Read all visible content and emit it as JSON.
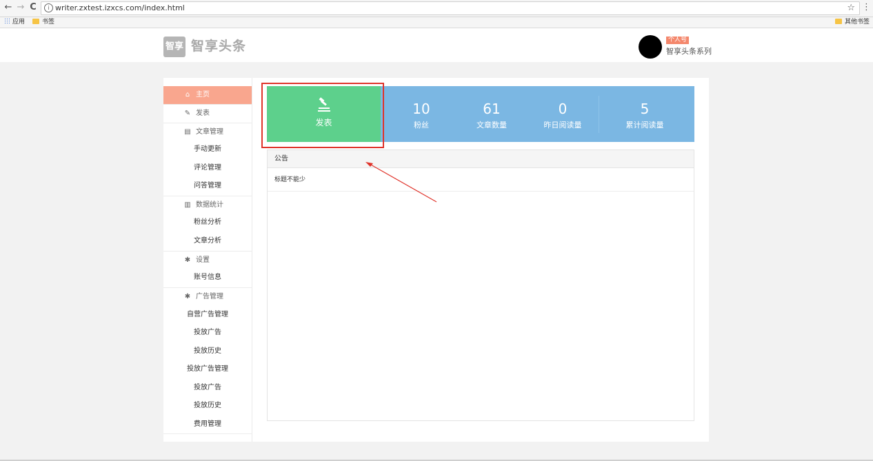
{
  "browser": {
    "back": "←",
    "forward": "→",
    "reload": "C",
    "info_icon": "i",
    "url": "writer.zxtest.izxcs.com/index.html",
    "star": "☆",
    "menu": "⋮",
    "bookmarks": [
      {
        "label": "应用",
        "icon": "apps-icon"
      },
      {
        "label": "书签",
        "icon": "folder-icon"
      }
    ],
    "other_bookmarks": "其他书签"
  },
  "header": {
    "logo_mark": "智享",
    "logo_text": "智享头条",
    "badge": "个人号",
    "account_name": "智享头条系列"
  },
  "sidebar": {
    "items": [
      {
        "label": "主页",
        "icon": "home-icon",
        "glyph": "⌂",
        "type": "section",
        "active": true
      },
      {
        "label": "发表",
        "icon": "edit-icon",
        "glyph": "✎",
        "type": "section"
      },
      {
        "label": "文章管理",
        "icon": "document-icon",
        "glyph": "▤",
        "type": "section"
      },
      {
        "label": "手动更新",
        "type": "sub"
      },
      {
        "label": "评论管理",
        "type": "sub"
      },
      {
        "label": "问答管理",
        "type": "sub"
      },
      {
        "label": "数据统计",
        "icon": "bar-chart-icon",
        "glyph": "▥",
        "type": "section"
      },
      {
        "label": "粉丝分析",
        "type": "sub"
      },
      {
        "label": "文章分析",
        "type": "sub"
      },
      {
        "label": "设置",
        "icon": "gear-icon",
        "glyph": "✱",
        "type": "section"
      },
      {
        "label": "账号信息",
        "type": "sub"
      },
      {
        "label": "广告管理",
        "icon": "gear-icon",
        "glyph": "✱",
        "type": "section"
      },
      {
        "label": "自营广告管理",
        "type": "sub"
      },
      {
        "label": "投放广告",
        "type": "sub"
      },
      {
        "label": "投放历史",
        "type": "sub"
      },
      {
        "label": "投放广告管理",
        "type": "sub"
      },
      {
        "label": "投放广告",
        "type": "sub"
      },
      {
        "label": "投放历史",
        "type": "sub"
      },
      {
        "label": "费用管理",
        "type": "sub"
      }
    ]
  },
  "publish": {
    "label": "发表",
    "icon": "gavel-icon"
  },
  "stats": [
    {
      "value": "10",
      "label": "粉丝"
    },
    {
      "value": "61",
      "label": "文章数量"
    },
    {
      "value": "0",
      "label": "昨日阅读量"
    },
    {
      "value": "5",
      "label": "累计阅读量"
    }
  ],
  "notice": {
    "title": "公告",
    "rows": [
      "标题不能少"
    ]
  },
  "colors": {
    "publish_bg": "#5dd08c",
    "stats_bg": "#7bb7e3",
    "active_nav": "#f9a68e",
    "highlight": "#e0332a",
    "badge": "#f4876c"
  }
}
